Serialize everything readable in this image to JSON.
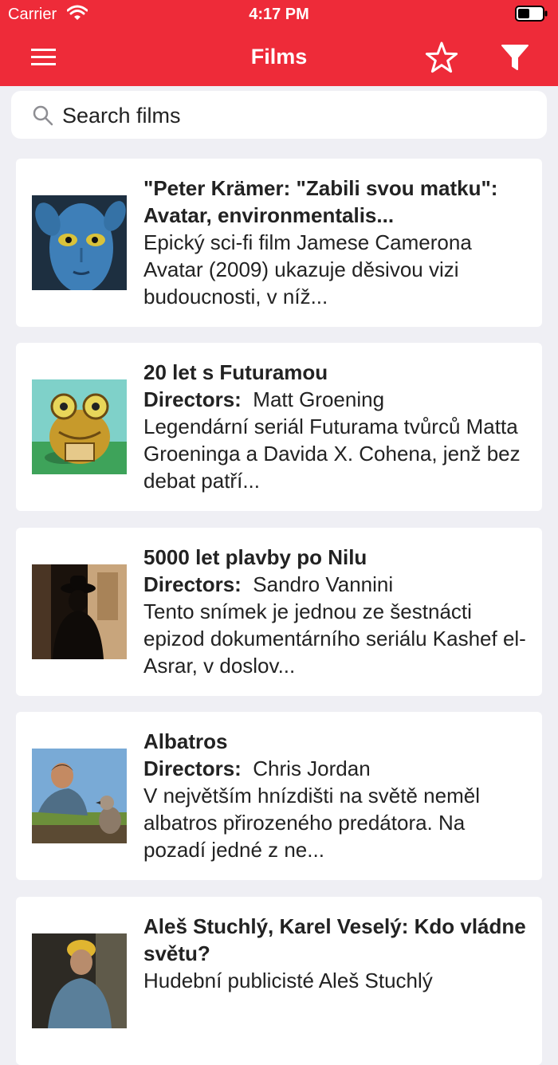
{
  "status_bar": {
    "carrier": "Carrier",
    "time": "4:17 PM"
  },
  "nav": {
    "title": "Films"
  },
  "search": {
    "placeholder": "Search films"
  },
  "directors_label": "Directors:",
  "colors": {
    "accent": "#ee2b39",
    "background": "#efeff4",
    "card": "#ffffff"
  },
  "films": [
    {
      "title": "\"Peter Krämer: \"Zabili svou matku\": Avatar, environmentalis...",
      "description": "Epický sci-fi film Jamese Camerona Avatar (2009) ukazuje děsivou vizi budoucnosti, v níž..."
    },
    {
      "title": "20 let s Futuramou",
      "directors": "Matt Groening",
      "description": "Legendární seriál Futurama tvůrců Matta Groeninga a Davida X. Cohena, jenž bez debat patří..."
    },
    {
      "title": "5000 let plavby po Nilu",
      "directors": "Sandro Vannini",
      "description": "Tento snímek je jednou ze šestnácti epizod dokumentárního seriálu Kashef el-Asrar, v doslov..."
    },
    {
      "title": "Albatros",
      "directors": "Chris Jordan",
      "description": "V největším hnízdišti na světě neměl albatros přirozeného predátora. Na pozadí jedné z ne..."
    },
    {
      "title": "Aleš Stuchlý, Karel Veselý: Kdo vládne světu?",
      "description": "Hudební publicisté Aleš Stuchlý"
    }
  ]
}
